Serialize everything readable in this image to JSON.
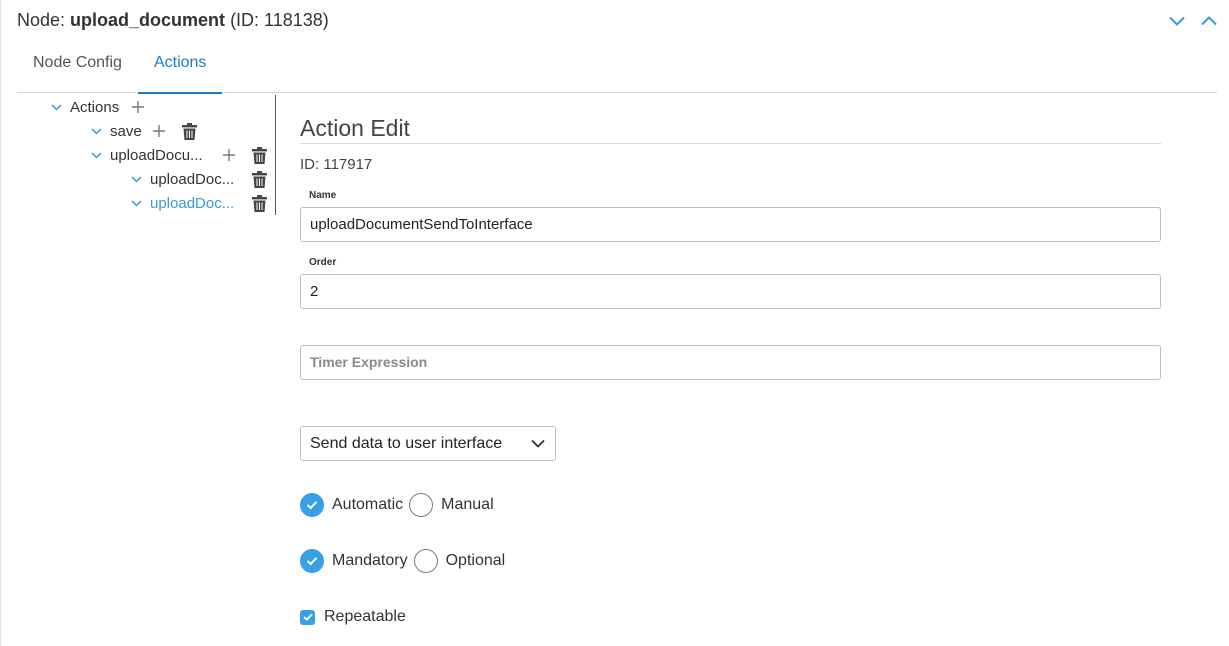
{
  "header": {
    "prefix": "Node: ",
    "node_name": "upload_document",
    "node_id": " (ID: 118138)",
    "collapse_icon": "chevron-down-icon",
    "expand_icon": "chevron-up-icon"
  },
  "tabs": [
    {
      "label": "Node Config",
      "active": false
    },
    {
      "label": "Actions",
      "active": true
    }
  ],
  "tree": {
    "root": {
      "label": "Actions"
    },
    "items": [
      {
        "label": "save"
      },
      {
        "label": "uploadDocu..."
      },
      {
        "label": "uploadDoc..."
      },
      {
        "label": "uploadDoc...",
        "selected": true
      }
    ]
  },
  "edit": {
    "title": "Action Edit",
    "id_text": "ID: 117917",
    "name_label": "Name",
    "name_value": "uploadDocumentSendToInterface",
    "order_label": "Order",
    "order_value": "2",
    "timer_placeholder": "Timer Expression",
    "select_value": "Send data to user interface",
    "trigger": {
      "automatic": "Automatic",
      "manual": "Manual",
      "selected": "automatic"
    },
    "requirement": {
      "mandatory": "Mandatory",
      "optional": "Optional",
      "selected": "mandatory"
    },
    "repeatable": {
      "label": "Repeatable",
      "checked": true
    }
  },
  "colors": {
    "accent": "#1a7cc9",
    "selected_tree_item": "#3a9ad9",
    "radio_on": "#3aa0e6"
  }
}
